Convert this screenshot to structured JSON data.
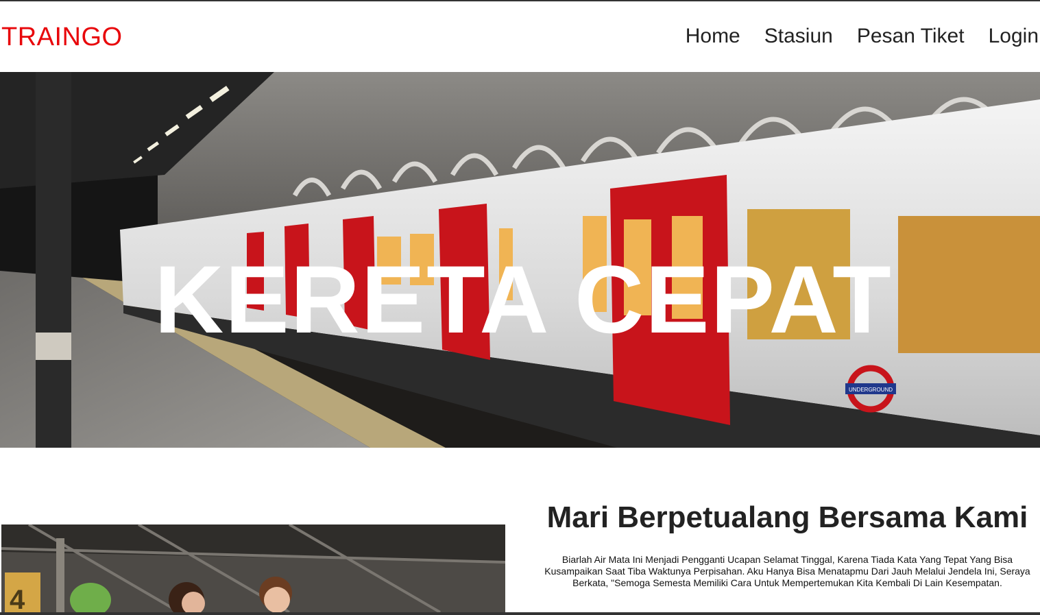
{
  "brand": {
    "name": "TRAINGO",
    "color": "#e8070b"
  },
  "nav": {
    "items": [
      {
        "label": "Home"
      },
      {
        "label": "Stasiun"
      },
      {
        "label": "Pesan Tiket"
      },
      {
        "label": "Login"
      }
    ]
  },
  "hero": {
    "title": "KERETA CEPAT",
    "roundel_text": "UNDERGROUND"
  },
  "about": {
    "heading": "Mari Berpetualang Bersama Kami",
    "body": "Biarlah Air Mata Ini Menjadi Pengganti Ucapan Selamat Tinggal, Karena Tiada Kata Yang Tepat Yang Bisa Kusampaikan Saat Tiba Waktunya Perpisahan. Aku Hanya Bisa Menatapmu Dari Jauh Melalui Jendela Ini, Seraya Berkata, \"Semoga Semesta Memiliki Cara Untuk Mempertemukan Kita Kembali Di Lain Kesempatan."
  },
  "photo": {
    "platform_number": "4"
  }
}
